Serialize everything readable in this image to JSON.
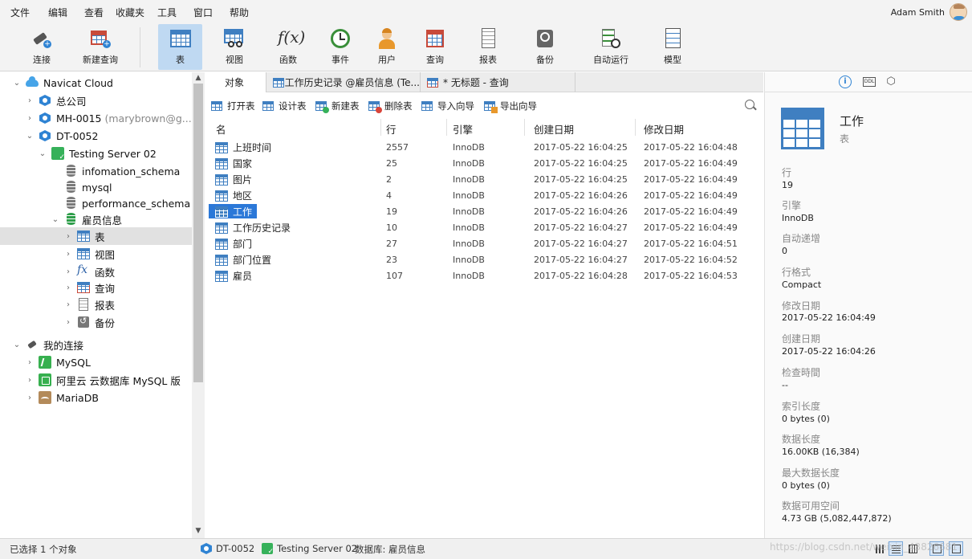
{
  "menu": [
    "文件",
    "编辑",
    "查看",
    "收藏夹",
    "工具",
    "窗口",
    "帮助"
  ],
  "user": {
    "name": "Adam Smith"
  },
  "toolbar": {
    "connect": "连接",
    "new_query": "新建查询",
    "table": "表",
    "view": "视图",
    "function": "函数",
    "event": "事件",
    "user": "用户",
    "query": "查询",
    "report": "报表",
    "backup": "备份",
    "automation": "自动运行",
    "model": "模型"
  },
  "sidebar": {
    "navicat_cloud": "Navicat Cloud",
    "company": "总公司",
    "mh": "MH-0015",
    "mh_sub": "(marybrown@g...",
    "dt": "DT-0052",
    "testing_server": "Testing Server 02",
    "db1": "infomation_schema",
    "db2": "mysql",
    "db3": "performance_schema",
    "db4": "雇员信息",
    "obj_table": "表",
    "obj_view": "视图",
    "obj_function": "函数",
    "obj_query": "查询",
    "obj_report": "报表",
    "obj_backup": "备份",
    "my_connections": "我的连接",
    "conn_mysql": "MySQL",
    "conn_aliyun": "阿里云 云数据库 MySQL 版",
    "conn_maria": "MariaDB"
  },
  "tabs": {
    "objects": "对象",
    "tab2": "工作历史记录 @雇员信息 (Te...",
    "tab3": "* 无标题 - 查询"
  },
  "obj_toolbar": {
    "open": "打开表",
    "design": "设计表",
    "new": "新建表",
    "delete": "删除表",
    "import": "导入向导",
    "export": "导出向导"
  },
  "columns": [
    "名",
    "行",
    "引擎",
    "创建日期",
    "修改日期"
  ],
  "rows": [
    {
      "name": "上班时间",
      "rows": "2557",
      "engine": "InnoDB",
      "created": "2017-05-22 16:04:25",
      "modified": "2017-05-22 16:04:48"
    },
    {
      "name": "国家",
      "rows": "25",
      "engine": "InnoDB",
      "created": "2017-05-22 16:04:25",
      "modified": "2017-05-22 16:04:49"
    },
    {
      "name": "图片",
      "rows": "2",
      "engine": "InnoDB",
      "created": "2017-05-22 16:04:25",
      "modified": "2017-05-22 16:04:49"
    },
    {
      "name": "地区",
      "rows": "4",
      "engine": "InnoDB",
      "created": "2017-05-22 16:04:26",
      "modified": "2017-05-22 16:04:49"
    },
    {
      "name": "工作",
      "rows": "19",
      "engine": "InnoDB",
      "created": "2017-05-22 16:04:26",
      "modified": "2017-05-22 16:04:49"
    },
    {
      "name": "工作历史记录",
      "rows": "10",
      "engine": "InnoDB",
      "created": "2017-05-22 16:04:27",
      "modified": "2017-05-22 16:04:49"
    },
    {
      "name": "部门",
      "rows": "27",
      "engine": "InnoDB",
      "created": "2017-05-22 16:04:27",
      "modified": "2017-05-22 16:04:51"
    },
    {
      "name": "部门位置",
      "rows": "23",
      "engine": "InnoDB",
      "created": "2017-05-22 16:04:27",
      "modified": "2017-05-22 16:04:52"
    },
    {
      "name": "雇员",
      "rows": "107",
      "engine": "InnoDB",
      "created": "2017-05-22 16:04:28",
      "modified": "2017-05-22 16:04:53"
    }
  ],
  "info": {
    "title": "工作",
    "subtitle": "表",
    "props": [
      {
        "label": "行",
        "value": "19"
      },
      {
        "label": "引擎",
        "value": "InnoDB"
      },
      {
        "label": "自动递增",
        "value": "0"
      },
      {
        "label": "行格式",
        "value": "Compact"
      },
      {
        "label": "修改日期",
        "value": "2017-05-22 16:04:49"
      },
      {
        "label": "创建日期",
        "value": "2017-05-22 16:04:26"
      },
      {
        "label": "检查時間",
        "value": "--"
      },
      {
        "label": "索引长度",
        "value": "0 bytes (0)"
      },
      {
        "label": "数据长度",
        "value": "16.00KB (16,384)"
      },
      {
        "label": "最大数据长度",
        "value": "0 bytes (0)"
      },
      {
        "label": "数据可用空间",
        "value": "4.73 GB (5,082,447,872)"
      }
    ]
  },
  "status": {
    "selected": "已选择 1 个对象",
    "dt": "DT-0052",
    "server": "Testing Server 02",
    "database": "数据库: 雇员信息",
    "watermark": "https://blog.csdn.net/weixin_43826681"
  },
  "colors": {
    "accent": "#2b78d8",
    "toolbar_active": "#bfd9f2",
    "table_icon": "#3f7fc1",
    "server_green": "#36b15a"
  }
}
